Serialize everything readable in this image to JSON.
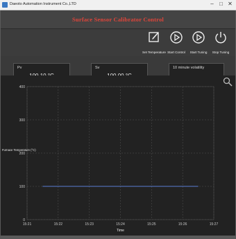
{
  "window": {
    "title": "Daeoto Automation Instrument Co.,LTD"
  },
  "header": {
    "title": "Surface Sensor Calibrator Control"
  },
  "toolbar": {
    "set_temperature": "Set Temperature",
    "start_control": "Start Control",
    "start_tuning": "Start Tuning",
    "stop_tuning": "Stop Tuning"
  },
  "readouts": {
    "pv_label": "Pv",
    "pv_value": "100.10 °C",
    "sv_label": "Sv",
    "sv_value": "100.00 °C",
    "volatility_label": "10 minute volatility"
  },
  "colors": {
    "header_title": "#e0443a",
    "series": "#5a7fd4",
    "chart_bg": "#222222"
  },
  "chart_data": {
    "type": "line",
    "ylabel": "Furnace Temperature (°C)",
    "xlabel": "Time",
    "y_ticks": [
      "0",
      "100",
      "200",
      "300",
      "400"
    ],
    "ylim": [
      0,
      400
    ],
    "x_ticks": [
      "15:21",
      "15:22",
      "15:23",
      "15:24",
      "15:25",
      "15:26",
      "15:27"
    ],
    "grid": true,
    "series": [
      {
        "values": [
          100,
          100,
          100,
          100,
          100,
          100
        ]
      }
    ]
  }
}
